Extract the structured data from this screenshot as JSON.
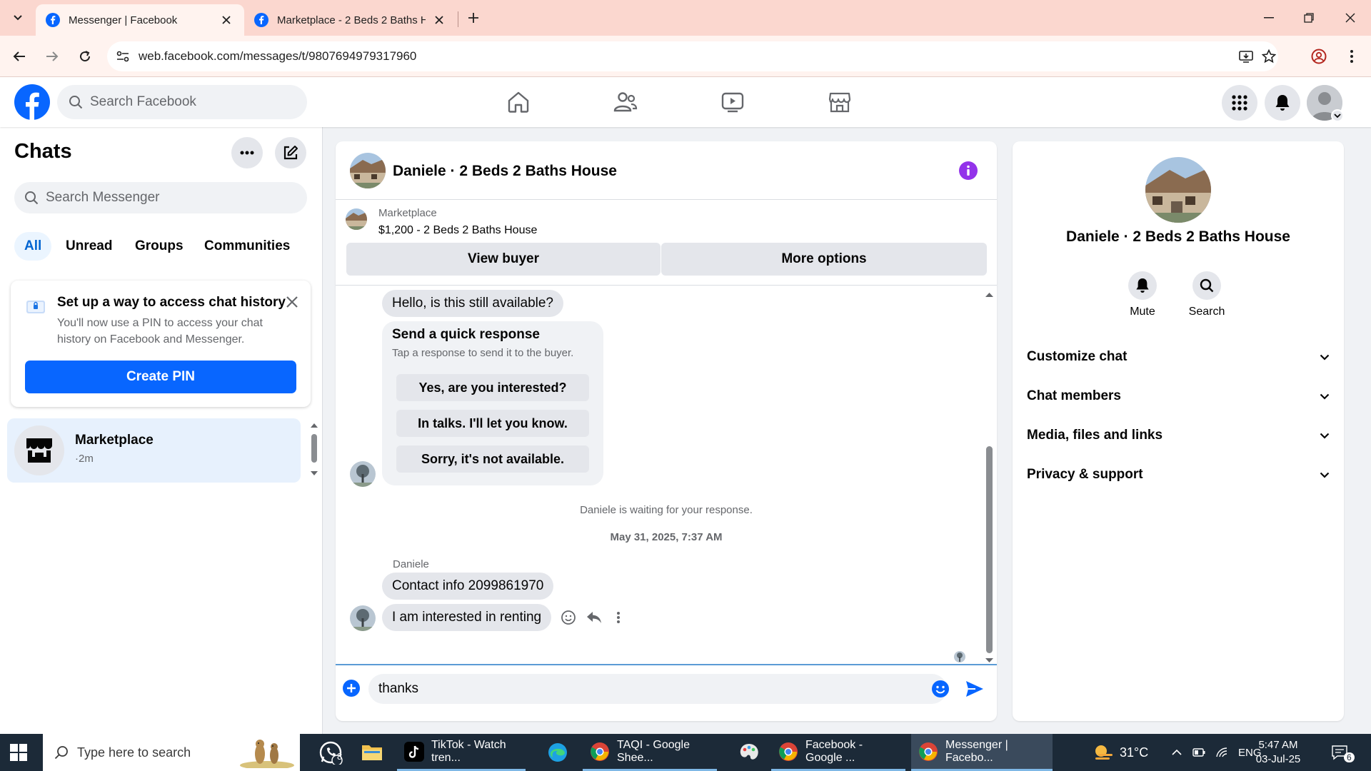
{
  "browser": {
    "tabs": [
      {
        "title": "Messenger | Facebook",
        "active": true
      },
      {
        "title": "Marketplace - 2 Beds 2 Baths H",
        "active": false
      }
    ],
    "url": "web.facebook.com/messages/t/9807694979317960"
  },
  "facebook": {
    "search_placeholder": "Search Facebook",
    "brand_color": "#0866ff"
  },
  "sidebar": {
    "title": "Chats",
    "search_placeholder": "Search Messenger",
    "filters": [
      "All",
      "Unread",
      "Groups",
      "Communities"
    ],
    "pin_card": {
      "title": "Set up a way to access chat history",
      "description": "You'll now use a PIN to access your chat history on Facebook and Messenger.",
      "button": "Create PIN"
    },
    "chats": [
      {
        "name": "Marketplace",
        "time": "·2m"
      }
    ]
  },
  "conversation": {
    "title": "Daniele · 2 Beds 2 Baths House",
    "marketplace_label": "Marketplace",
    "listing": "$1,200 - 2 Beds 2 Baths House",
    "view_buyer": "View buyer",
    "more_options": "More options",
    "messages": {
      "first": "Hello, is this still available?",
      "quick_title": "Send a quick response",
      "quick_sub": "Tap a response to send it to the buyer.",
      "quick_options": [
        "Yes, are you interested?",
        "In talks. I'll let you know.",
        "Sorry, it's not available."
      ],
      "waiting": "Daniele is waiting for your response.",
      "date": "May 31, 2025, 7:37 AM",
      "sender": "Daniele",
      "msg1": "Contact info 2099861970",
      "msg2": "I am interested in renting"
    },
    "composer_value": "thanks"
  },
  "details": {
    "name": "Daniele · 2 Beds 2 Baths House",
    "actions": [
      "Mute",
      "Search"
    ],
    "sections": [
      "Customize chat",
      "Chat members",
      "Media, files and links",
      "Privacy & support"
    ]
  },
  "taskbar": {
    "search_placeholder": "Type here to search",
    "whatsapp_badge": "8",
    "apps": [
      "TikTok - Watch tren...",
      "TAQI - Google Shee...",
      "Facebook - Google ...",
      "Messenger | Facebo..."
    ],
    "temperature": "31°C",
    "language": "ENG",
    "time": "5:47 AM",
    "date": "03-Jul-25",
    "notifications": "6"
  }
}
